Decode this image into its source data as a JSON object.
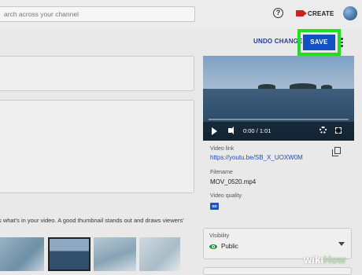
{
  "header": {
    "search_placeholder": "arch across your channel",
    "help_glyph": "?",
    "create_label": "CREATE"
  },
  "toolbar": {
    "undo_label": "UNDO CHANGES",
    "save_label": "SAVE",
    "highlight_color": "#22dd22",
    "save_color": "#1250c4"
  },
  "player": {
    "time": "0:00 / 1:01"
  },
  "details": {
    "video_link_label": "Video link",
    "video_link": "https://youtu.be/SB_X_UOXW0M",
    "filename_label": "Filename",
    "filename": "MOV_0520.mp4",
    "quality_label": "Video quality",
    "quality_badge": "SD"
  },
  "thumbnail": {
    "hint": "s what's in your video. A good thumbnail stands out and draws viewers'"
  },
  "visibility": {
    "label": "Visibility",
    "value": "Public"
  },
  "watermark": {
    "prefix": "wiki",
    "suffix": "How"
  }
}
